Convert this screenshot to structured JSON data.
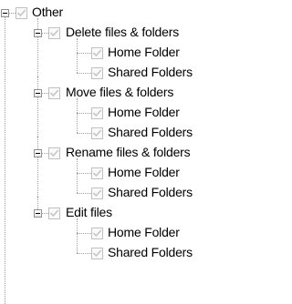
{
  "tree": {
    "root": {
      "label": "Other",
      "checked": true,
      "expanded": true,
      "children": [
        {
          "label": "Delete files & folders",
          "checked": true,
          "expanded": true,
          "children": [
            {
              "label": "Home Folder",
              "checked": true
            },
            {
              "label": "Shared Folders",
              "checked": true
            }
          ]
        },
        {
          "label": "Move files & folders",
          "checked": true,
          "expanded": true,
          "children": [
            {
              "label": "Home Folder",
              "checked": true
            },
            {
              "label": "Shared Folders",
              "checked": true
            }
          ]
        },
        {
          "label": "Rename files & folders",
          "checked": true,
          "expanded": true,
          "children": [
            {
              "label": "Home Folder",
              "checked": true
            },
            {
              "label": "Shared Folders",
              "checked": true
            }
          ]
        },
        {
          "label": "Edit files",
          "checked": true,
          "expanded": true,
          "children": [
            {
              "label": "Home Folder",
              "checked": true
            },
            {
              "label": "Shared Folders",
              "checked": true
            }
          ]
        }
      ]
    }
  },
  "colors": {
    "check_disabled": "#c6c6c6",
    "checkbox_border": "#c0c0c0",
    "tree_lines": "#a0a0a0",
    "expander_border": "#919191",
    "text": "#000000"
  },
  "icons": {
    "expander": "minus-box-icon",
    "checkbox": "check-icon"
  }
}
